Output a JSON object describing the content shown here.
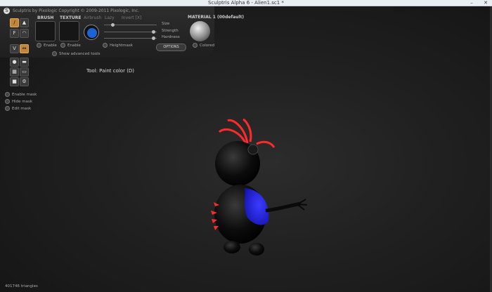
{
  "window": {
    "title": "Sculptris Alpha 6 - Alien1.sc1 *",
    "minimize_glyph": "–",
    "close_glyph": "✕"
  },
  "toolbar": {
    "header": "Sculptris by Pixologic   Copyright © 2009-2011 Pixologic, Inc.",
    "brush_label": "BRUSH",
    "texture_label": "TEXTURE",
    "airbrush_label": "Airbrush",
    "lazy_label": "Lazy",
    "invert_label": "Invert [X]",
    "size_label": "Size",
    "strength_label": "Strength",
    "hardness_label": "Hardness",
    "brush_enable": "Enable",
    "texture_enable": "Enable",
    "heightmask_label": "Heightmask",
    "options_label": "OPTIONS",
    "material_label": "MATERIAL 1 (00default)",
    "colored_label": "Colored",
    "advanced_tools_label": "Show advanced tools",
    "color_swatch": "#1e63d6"
  },
  "tool_label": "Tool: Paint color (D)",
  "mask": {
    "enable": "Enable mask",
    "hide": "Hide mask",
    "edit": "Edit mask"
  },
  "status": {
    "triangles": "401746 triangles"
  }
}
